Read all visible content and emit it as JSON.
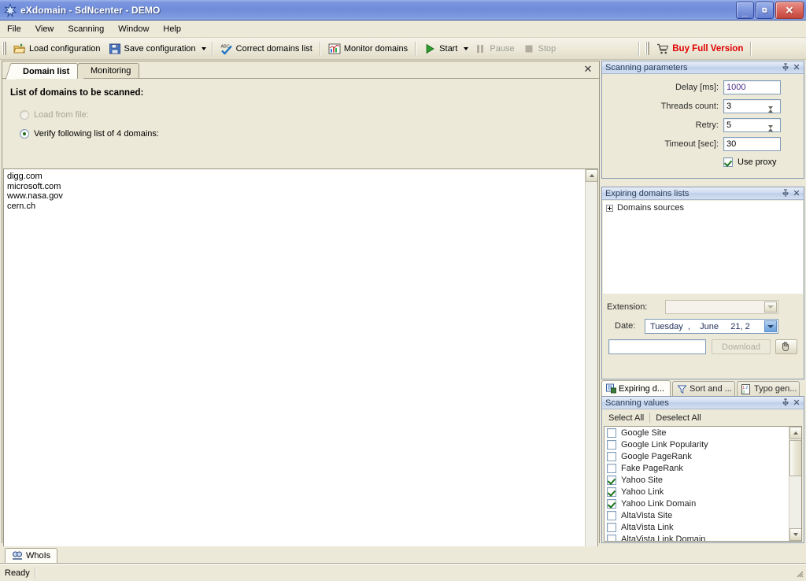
{
  "window": {
    "title": "eXdomain - SdNcenter - DEMO",
    "icon": "app-star-icon",
    "buttons": {
      "minimize": "_",
      "restore": "❐",
      "close": "✕"
    }
  },
  "menu": {
    "items": [
      {
        "label": "File"
      },
      {
        "label": "View"
      },
      {
        "label": "Scanning"
      },
      {
        "label": "Window"
      },
      {
        "label": "Help"
      }
    ]
  },
  "toolbar": {
    "load_configuration": "Load configuration",
    "save_configuration": "Save configuration",
    "correct_domains_list": "Correct domains list",
    "monitor_domains": "Monitor domains",
    "start": "Start",
    "pause": "Pause",
    "stop": "Stop",
    "buy_full_version": "Buy Full Version"
  },
  "main_panel": {
    "tabs": [
      {
        "label": "Domain list",
        "active": true
      },
      {
        "label": "Monitoring",
        "active": false
      }
    ],
    "close_glyph": "✕",
    "section_title": "List of domains to be scanned:",
    "load_from_file_label": "Load from file:",
    "load_from_file_value": "",
    "load_from_file_placeholder": "",
    "browse_label": "...",
    "verify_list_label": "Verify following list of 4 domains:",
    "domains": [
      "digg.com",
      "microsoft.com",
      "www.nasa.gov",
      "cern.ch"
    ]
  },
  "scanning_parameters": {
    "title": "Scanning parameters",
    "pin_glyph": "⚓",
    "close_glyph": "✕",
    "delay_label": "Delay [ms]:",
    "delay_value": "1000",
    "threads_label": "Threads count:",
    "threads_value": "3",
    "retry_label": "Retry:",
    "retry_value": "5",
    "timeout_label": "Timeout [sec]:",
    "timeout_value": "30",
    "use_proxy_label": "Use proxy",
    "use_proxy_checked": true
  },
  "expiring_domains": {
    "title": "Expiring domains lists",
    "pin_glyph": "⚓",
    "close_glyph": "✕",
    "tree_root": "Domains sources",
    "extension_label": "Extension:",
    "extension_value": "",
    "date_label": "Date:",
    "date_value": "Tuesday  ,    June     21, 2",
    "filter_value": "",
    "download_label": "Download",
    "stop_icon": "hand-stop-icon",
    "tabs": [
      {
        "label": "Expiring d...",
        "icon": "expiring-list-icon",
        "active": true
      },
      {
        "label": "Sort and ...",
        "icon": "funnel-icon",
        "active": false
      },
      {
        "label": "Typo gen...",
        "icon": "typo-gen-icon",
        "active": false
      }
    ]
  },
  "scanning_values": {
    "title": "Scanning values",
    "pin_glyph": "⚓",
    "close_glyph": "✕",
    "select_all": "Select All",
    "deselect_all": "Deselect All",
    "items": [
      {
        "label": "Google Site",
        "checked": false
      },
      {
        "label": "Google Link Popularity",
        "checked": false
      },
      {
        "label": "Google PageRank",
        "checked": false
      },
      {
        "label": "Fake PageRank",
        "checked": false
      },
      {
        "label": "Yahoo Site",
        "checked": true
      },
      {
        "label": "Yahoo Link",
        "checked": true
      },
      {
        "label": "Yahoo Link Domain",
        "checked": true
      },
      {
        "label": "AltaVista Site",
        "checked": false
      },
      {
        "label": "AltaVista Link",
        "checked": false
      },
      {
        "label": "AltaVista Link Domain",
        "checked": false
      }
    ]
  },
  "bottom": {
    "whois_tab": "WhoIs",
    "whois_icon": "whois-icon",
    "status_text": "Ready"
  },
  "colors": {
    "title_bar": "#7b96df",
    "face": "#ece9d8",
    "buy_red": "#e00000",
    "panel_header": "#cedbef",
    "check_green": "#197419"
  }
}
